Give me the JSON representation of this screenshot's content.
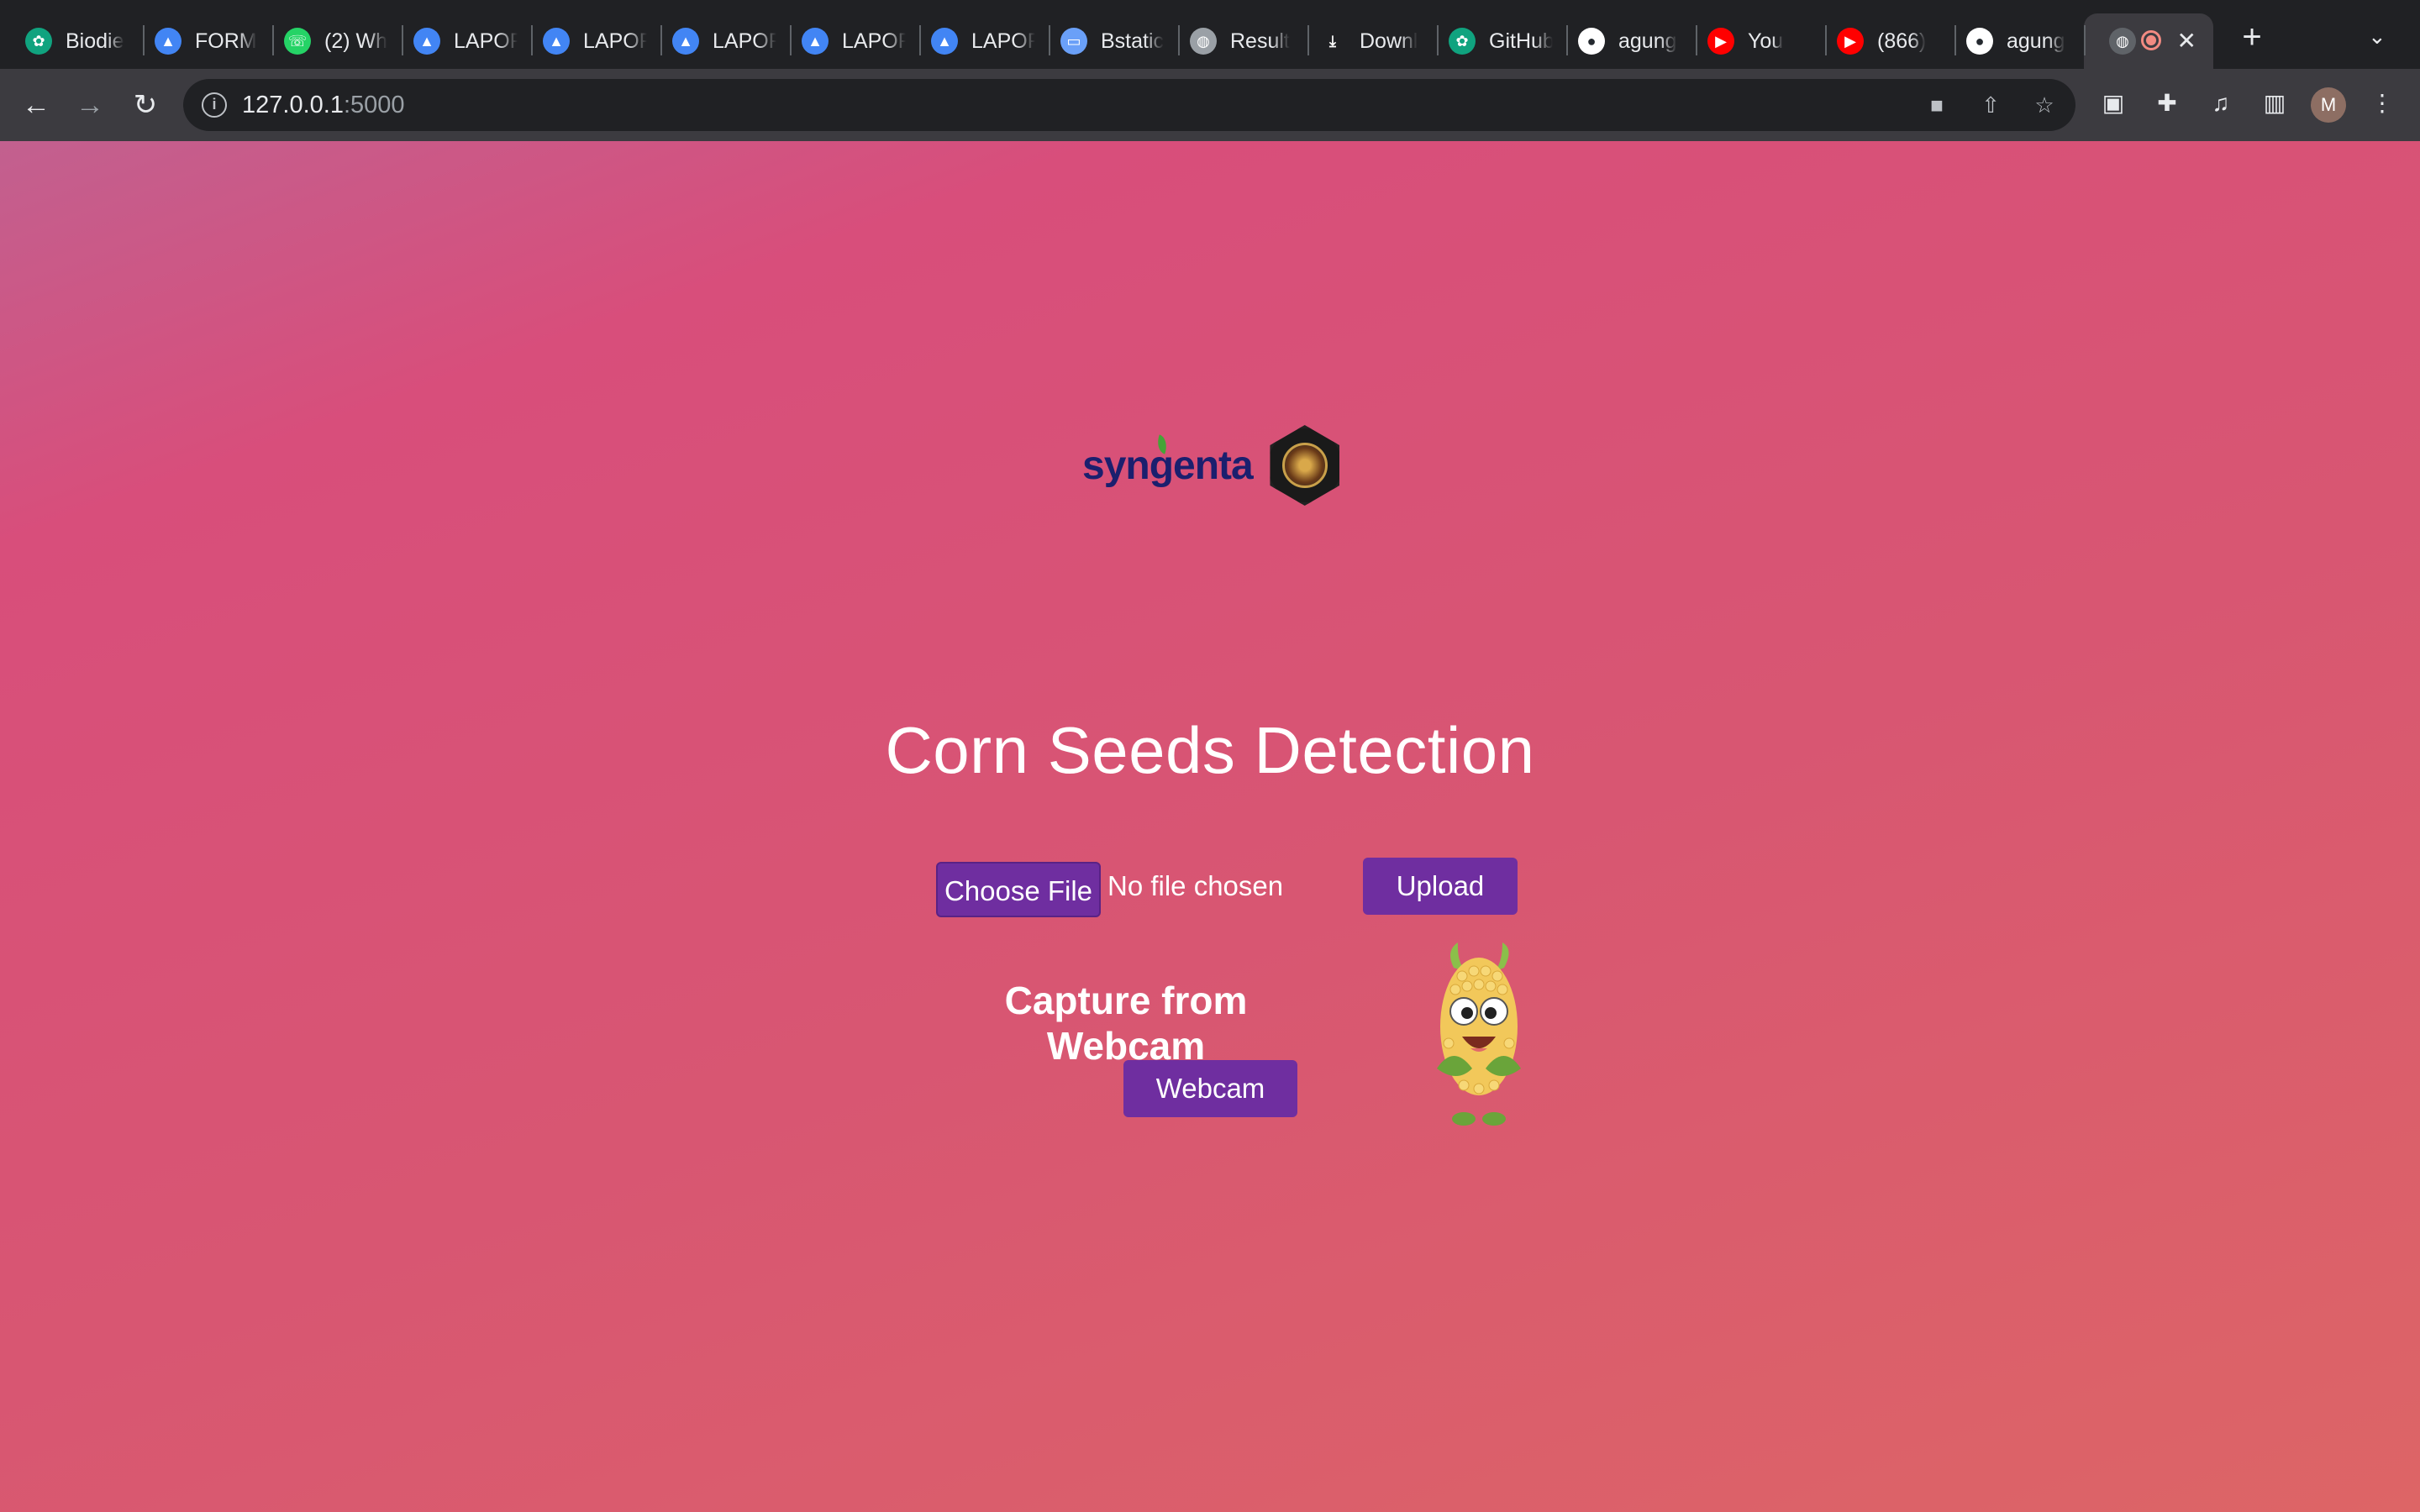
{
  "browser": {
    "tabs": [
      {
        "title": "Biodie",
        "icon": "openai-icon",
        "color": "#10a37f"
      },
      {
        "title": "FORM",
        "icon": "google-drive-icon",
        "color": "#4285f4"
      },
      {
        "title": "(2) Wh",
        "icon": "whatsapp-icon",
        "color": "#25d366"
      },
      {
        "title": "LAPOF",
        "icon": "google-drive-icon",
        "color": "#4285f4"
      },
      {
        "title": "LAPOF",
        "icon": "google-drive-icon",
        "color": "#4285f4"
      },
      {
        "title": "LAPOF",
        "icon": "google-drive-icon",
        "color": "#4285f4"
      },
      {
        "title": "LAPOF",
        "icon": "google-drive-icon",
        "color": "#4285f4"
      },
      {
        "title": "LAPOF",
        "icon": "google-drive-icon",
        "color": "#4285f4"
      },
      {
        "title": "Bstatic",
        "icon": "bilibili-icon",
        "color": "#6aa0f8"
      },
      {
        "title": "Result",
        "icon": "globe-icon",
        "color": "#9aa0a6"
      },
      {
        "title": "Downl",
        "icon": "download-icon",
        "color": "#e8eaed"
      },
      {
        "title": "GitHub",
        "icon": "openai-icon",
        "color": "#10a37f"
      },
      {
        "title": "agung",
        "icon": "github-icon",
        "color": "#24292f"
      },
      {
        "title": "You",
        "icon": "youtube-music-icon",
        "color": "#ff0000"
      },
      {
        "title": "(866)",
        "icon": "youtube-icon",
        "color": "#ff0000"
      },
      {
        "title": "agung",
        "icon": "github-icon",
        "color": "#ffffff"
      }
    ],
    "active_tab": {
      "icon": "globe-icon"
    },
    "url": {
      "host": "127.0.0.1",
      "port": ":5000"
    },
    "profile_initial": "M"
  },
  "page": {
    "logo_text": "syngenta",
    "title": "Corn Seeds Detection",
    "choose_file_label": "Choose File",
    "no_file_text": "No file chosen",
    "upload_label": "Upload",
    "webcam_heading": "Capture from Webcam",
    "webcam_label": "Webcam"
  },
  "colors": {
    "button": "#6f2ea0",
    "gradient_start": "#c2608f",
    "gradient_end": "#dd6566"
  }
}
